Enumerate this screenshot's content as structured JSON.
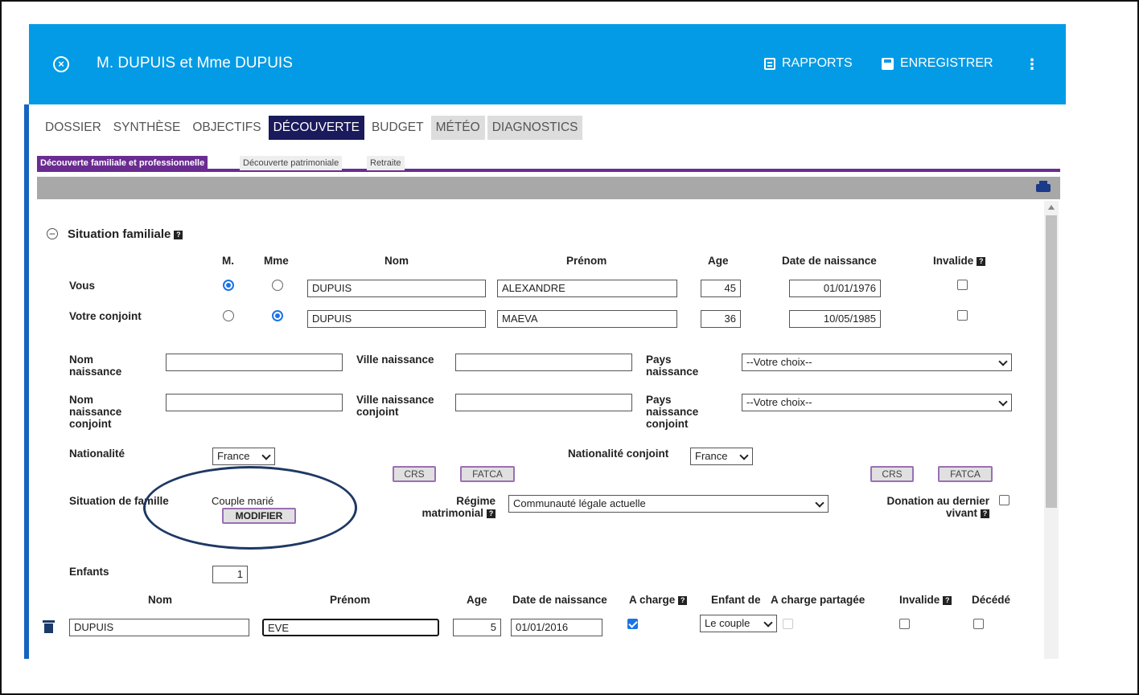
{
  "header": {
    "title": "M. DUPUIS et Mme DUPUIS",
    "reports_label": "RAPPORTS",
    "save_label": "ENREGISTRER"
  },
  "tabs": [
    "DOSSIER",
    "SYNTHÈSE",
    "OBJECTIFS",
    "DÉCOUVERTE",
    "BUDGET",
    "MÉTÉO",
    "DIAGNOSTICS"
  ],
  "subtabs": [
    "Découverte familiale et professionnelle",
    "Découverte patrimoniale",
    "Retraite"
  ],
  "section": {
    "title": "Situation familiale",
    "help": "?"
  },
  "persons_header": {
    "m": "M.",
    "mme": "Mme",
    "nom": "Nom",
    "prenom": "Prénom",
    "age": "Age",
    "dob": "Date de naissance",
    "invalide": "Invalide"
  },
  "persons": [
    {
      "label": "Vous",
      "civility": "M.",
      "nom": "DUPUIS",
      "prenom": "ALEXANDRE",
      "age": "45",
      "dob": "01/01/1976",
      "invalide": false
    },
    {
      "label": "Votre conjoint",
      "civility": "Mme",
      "nom": "DUPUIS",
      "prenom": "MAEVA",
      "age": "36",
      "dob": "10/05/1985",
      "invalide": false
    }
  ],
  "birth": {
    "nom_naissance": "Nom naissance",
    "ville_naissance": "Ville naissance",
    "pays_naissance": "Pays naissance",
    "nom_naissance_conjoint": "Nom naissance conjoint",
    "ville_naissance_conjoint": "Ville naissance conjoint",
    "pays_naissance_conjoint": "Pays naissance conjoint",
    "pays_choice": "--Votre choix--"
  },
  "nationality": {
    "label": "Nationalité",
    "value": "France",
    "conjoint_label": "Nationalité conjoint",
    "conjoint_value": "France",
    "crs": "CRS",
    "fatca": "FATCA"
  },
  "situation": {
    "label": "Situation de famille",
    "value": "Couple marié",
    "modify": "MODIFIER",
    "regime_label": "Régime matrimonial",
    "regime_value": "Communauté légale actuelle",
    "donation_label": "Donation au dernier vivant"
  },
  "children": {
    "label": "Enfants",
    "count": "1",
    "headers": {
      "nom": "Nom",
      "prenom": "Prénom",
      "age": "Age",
      "dob": "Date de naissance",
      "charge": "A charge",
      "enfant_de": "Enfant de",
      "charge_partagee": "A charge partagée",
      "invalide": "Invalide",
      "decede": "Décédé"
    },
    "rows": [
      {
        "nom": "DUPUIS",
        "prenom": "EVE",
        "age": "5",
        "dob": "01/01/2016",
        "a_charge": true,
        "enfant_de": "Le couple",
        "charge_partagee": false,
        "invalide": false,
        "decede": false
      }
    ]
  },
  "colors": {
    "header": "#039be5",
    "active_tab": "#1a1a5c",
    "subtab_accent": "#6a2c91",
    "ellipse": "#1f3864"
  }
}
